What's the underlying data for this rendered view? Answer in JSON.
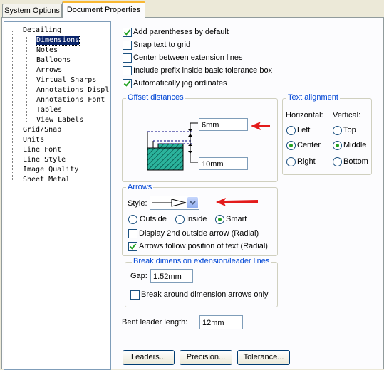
{
  "tabs": [
    {
      "label": "System Options"
    },
    {
      "label": "Document Properties"
    }
  ],
  "tree": {
    "items": [
      {
        "label": "Detailing"
      },
      {
        "label": "Dimensions"
      },
      {
        "label": "Notes"
      },
      {
        "label": "Balloons"
      },
      {
        "label": "Arrows"
      },
      {
        "label": "Virtual Sharps"
      },
      {
        "label": "Annotations Displ"
      },
      {
        "label": "Annotations Font"
      },
      {
        "label": "Tables"
      },
      {
        "label": "View Labels"
      },
      {
        "label": "Grid/Snap"
      },
      {
        "label": "Units"
      },
      {
        "label": "Line Font"
      },
      {
        "label": "Line Style"
      },
      {
        "label": "Image Quality"
      },
      {
        "label": "Sheet Metal"
      }
    ],
    "selected": "Dimensions"
  },
  "options": [
    {
      "label": "Add parentheses by default",
      "checked": true
    },
    {
      "label": "Snap text to grid",
      "checked": false
    },
    {
      "label": "Center between extension lines",
      "checked": false
    },
    {
      "label": "Include prefix inside basic tolerance box",
      "checked": false
    },
    {
      "label": "Automatically jog ordinates",
      "checked": true
    }
  ],
  "offset": {
    "title": "Offset distances",
    "top_value": "6mm",
    "bottom_value": "10mm"
  },
  "text_alignment": {
    "title": "Text alignment",
    "horizontal_label": "Horizontal:",
    "vertical_label": "Vertical:",
    "horizontal": [
      "Left",
      "Center",
      "Right"
    ],
    "horizontal_selected": "Center",
    "vertical": [
      "Top",
      "Middle",
      "Bottom"
    ],
    "vertical_selected": "Middle"
  },
  "arrows": {
    "title": "Arrows",
    "style_label": "Style:",
    "placement": [
      "Outside",
      "Inside",
      "Smart"
    ],
    "placement_selected": "Smart",
    "display_2nd": {
      "label": "Display 2nd outside arrow (Radial)",
      "checked": false
    },
    "follow_text": {
      "label": "Arrows follow position of text (Radial)",
      "checked": true
    }
  },
  "break": {
    "title": "Break dimension extension/leader lines",
    "gap_label": "Gap:",
    "gap_value": "1.52mm",
    "break_around": {
      "label": "Break around dimension arrows only",
      "checked": false
    }
  },
  "bent_leader": {
    "label": "Bent leader length:",
    "value": "12mm"
  },
  "buttons": [
    {
      "label": "Leaders..."
    },
    {
      "label": "Precision..."
    },
    {
      "label": "Tolerance..."
    }
  ],
  "colors": {
    "accent": "#0046d5",
    "annotation_arrow": "#e31b1b",
    "hatch": "#1e9e8a"
  }
}
